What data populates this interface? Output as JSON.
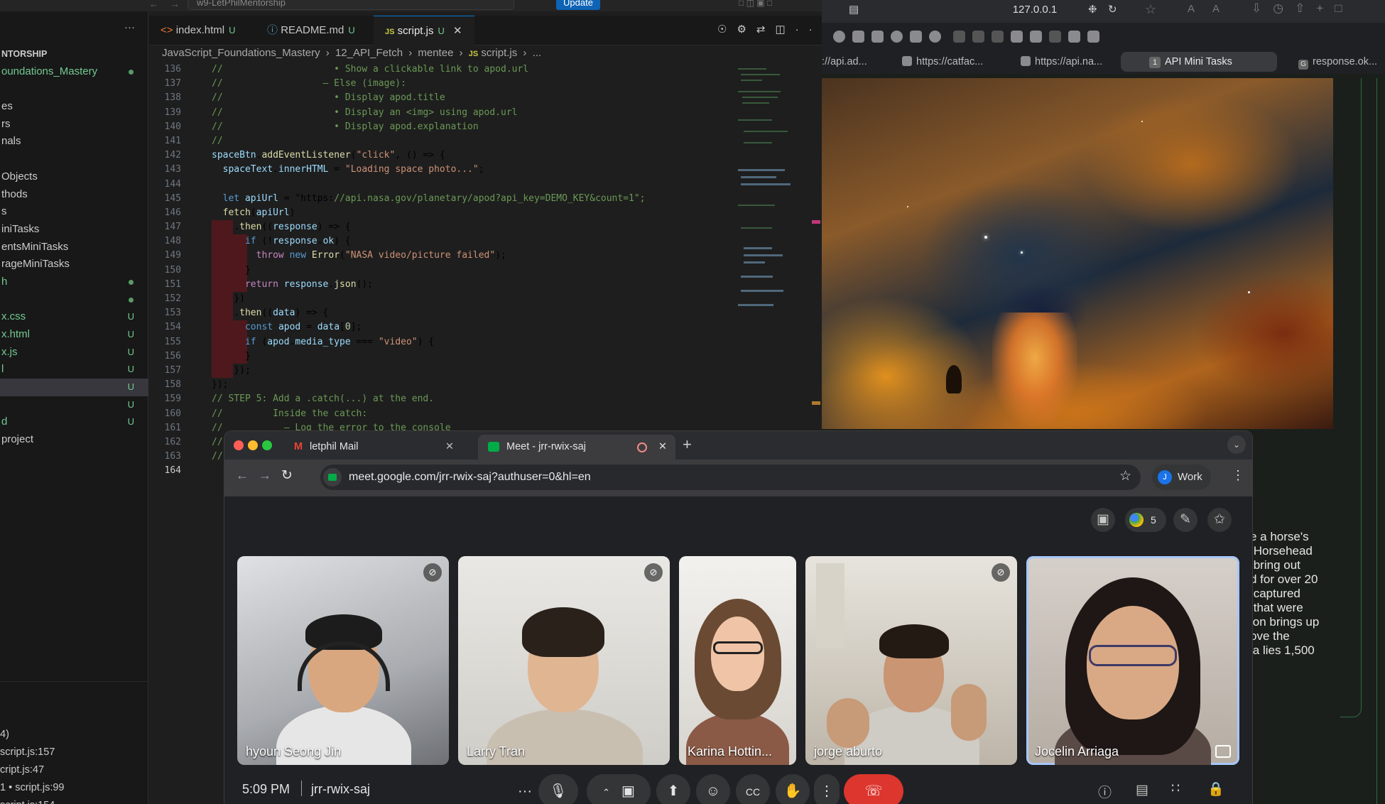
{
  "vscode": {
    "window_title": "w9-LetPhilMentorship",
    "update_label": "Update",
    "sidebar": {
      "items": [
        {
          "label": "NTORSHIP",
          "style": "header"
        },
        {
          "label": "oundations_Mastery",
          "style": "green",
          "marker": "dot"
        },
        {
          "label": "",
          "style": ""
        },
        {
          "label": "es",
          "style": ""
        },
        {
          "label": "rs",
          "style": ""
        },
        {
          "label": "nals",
          "style": ""
        },
        {
          "label": "",
          "style": ""
        },
        {
          "label": "Objects",
          "style": ""
        },
        {
          "label": "thods",
          "style": ""
        },
        {
          "label": "s",
          "style": ""
        },
        {
          "label": "iniTasks",
          "style": ""
        },
        {
          "label": "entsMiniTasks",
          "style": ""
        },
        {
          "label": "rageMiniTasks",
          "style": ""
        },
        {
          "label": "h",
          "style": "green",
          "marker": "dot"
        },
        {
          "label": "",
          "style": "",
          "marker": "dot"
        },
        {
          "label": "x.css",
          "style": "green",
          "marker": "U"
        },
        {
          "label": "x.html",
          "style": "green",
          "marker": "U"
        },
        {
          "label": "x.js",
          "style": "green",
          "marker": "U"
        },
        {
          "label": "l",
          "style": "green",
          "marker": "U"
        },
        {
          "label": "",
          "style": "sel",
          "marker": "U"
        },
        {
          "label": "",
          "style": "",
          "marker": "U"
        },
        {
          "label": "d",
          "style": "green",
          "marker": "U"
        },
        {
          "label": "project",
          "style": ""
        },
        {
          "label": "",
          "style": ""
        }
      ],
      "output_rows": [
        "4)",
        "script.js:157",
        "cript.js:47",
        "1  •  script.js:99",
        "  script.js:154"
      ]
    },
    "tabs": [
      {
        "label": "index.html",
        "mod": "U",
        "icon": "<>"
      },
      {
        "label": "README.md",
        "mod": "U",
        "icon": "ⓘ"
      },
      {
        "label": "script.js",
        "mod": "U",
        "icon": "JS"
      }
    ],
    "breadcrumb": [
      "JavaScript_Foundations_Mastery",
      "12_API_Fetch",
      "mentee",
      "script.js",
      "..."
    ],
    "code_lines": [
      {
        "n": "136",
        "t": "//                    • Show a clickable link to apod.url"
      },
      {
        "n": "137",
        "t": "//                  – Else (image):"
      },
      {
        "n": "138",
        "t": "//                    • Display apod.title"
      },
      {
        "n": "139",
        "t": "//                    • Display an <img> using apod.url"
      },
      {
        "n": "140",
        "t": "//                    • Display apod.explanation"
      },
      {
        "n": "141",
        "t": "//"
      },
      {
        "n": "142",
        "t": "spaceBtn.addEventListener(\"click\", () => {"
      },
      {
        "n": "143",
        "t": "  spaceText.innerHTML = \"Loading space photo...\";"
      },
      {
        "n": "144",
        "t": ""
      },
      {
        "n": "145",
        "t": "  let apiUrl = \"https://api.nasa.gov/planetary/apod?api_key=DEMO_KEY&count=1\";"
      },
      {
        "n": "146",
        "t": "  fetch(apiUrl)"
      },
      {
        "n": "147",
        "t": "    .then((response) => {"
      },
      {
        "n": "148",
        "t": "      if (!response.ok) {"
      },
      {
        "n": "149",
        "t": "        throw new Error(\"NASA video/picture failed\");"
      },
      {
        "n": "150",
        "t": "      }"
      },
      {
        "n": "151",
        "t": "      return response.json();"
      },
      {
        "n": "152",
        "t": "    })"
      },
      {
        "n": "153",
        "t": "    .then((data) => {"
      },
      {
        "n": "154",
        "t": "      const apod = data[0];"
      },
      {
        "n": "155",
        "t": "      if (apod.media_type === \"video\") {"
      },
      {
        "n": "156",
        "t": "      }"
      },
      {
        "n": "157",
        "t": "    });"
      },
      {
        "n": "158",
        "t": "});"
      },
      {
        "n": "159",
        "t": "// STEP 5: Add a .catch(...) at the end."
      },
      {
        "n": "160",
        "t": "//         Inside the catch:"
      },
      {
        "n": "161",
        "t": "//           – Log the error to the console"
      },
      {
        "n": "162",
        "t": "//"
      },
      {
        "n": "163",
        "t": "//"
      },
      {
        "n": "164",
        "t": ""
      }
    ]
  },
  "browser": {
    "address": "127.0.0.1",
    "tabs": [
      {
        "label": "://api.ad..."
      },
      {
        "label": "https://catfac..."
      },
      {
        "label": "https://api.na..."
      },
      {
        "label": "API Mini Tasks",
        "badge": "1"
      },
      {
        "label": "response.ok..."
      }
    ],
    "explanation_lines": "e a horse's\n Horsehead\n bring out\nd for over 20\n captured\n that were\nion brings up\nove the\nla lies 1,500"
  },
  "chrome": {
    "tabs": [
      {
        "label": "letphil Mail"
      },
      {
        "label": "Meet - jrr-rwix-saj"
      }
    ],
    "url": "meet.google.com/jrr-rwix-saj?authuser=0&hl=en",
    "profile_label": "Work",
    "profile_initial": "J"
  },
  "meet": {
    "participant_count": "5",
    "participants": [
      {
        "name": "hyoun Seong Jin",
        "muted": true
      },
      {
        "name": "Larry Tran",
        "muted": true
      },
      {
        "name": "Karina Hottin...",
        "muted": false
      },
      {
        "name": "jorge aburto",
        "muted": true
      },
      {
        "name": "Jocelin Arriaga",
        "muted": false
      }
    ],
    "time": "5:09 PM",
    "meeting_code": "jrr-rwix-saj"
  },
  "colors": {
    "vscode_bg": "#1e1e1e",
    "accent_blue": "#0078d4",
    "git_untracked": "#73c991",
    "meet_bg": "#202124",
    "hangup_red": "#dc362e",
    "speaker_highlight": "#a8c7fa"
  }
}
